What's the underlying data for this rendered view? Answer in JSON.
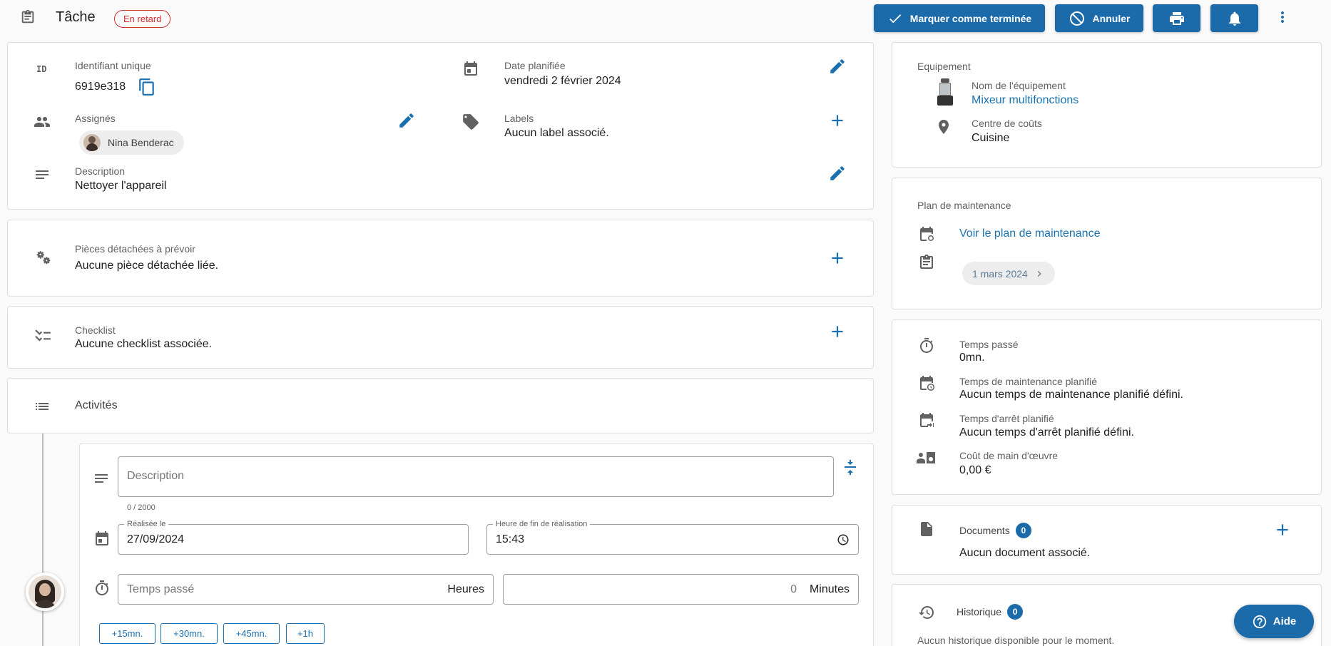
{
  "header": {
    "title": "Tâche",
    "status_badge": "En retard",
    "buttons": {
      "complete": "Marquer comme terminée",
      "cancel": "Annuler"
    }
  },
  "details": {
    "id_label": "Identifiant unique",
    "id_icon_text": "ID",
    "id_value": "6919e318",
    "date_label": "Date planifiée",
    "date_value": "vendredi 2 février 2024",
    "assignees_label": "Assignés",
    "assignee_name": "Nina Benderac",
    "labels_label": "Labels",
    "labels_value": "Aucun label associé.",
    "description_label": "Description",
    "description_value": "Nettoyer l'appareil"
  },
  "parts": {
    "label": "Pièces détachées à prévoir",
    "value": "Aucune pièce détachée liée."
  },
  "checklist": {
    "label": "Checklist",
    "value": "Aucune checklist associée."
  },
  "activities": {
    "title": "Activités",
    "description_placeholder": "Description",
    "char_count": "0 / 2000",
    "done_date_label": "Réalisée le",
    "done_date_value": "27/09/2024",
    "end_time_label": "Heure de fin de réalisation",
    "end_time_value": "15:43",
    "time_spent_placeholder": "Temps passé",
    "hours_unit": "Heures",
    "minutes_value": "0",
    "minutes_unit": "Minutes",
    "quick_buttons": [
      "+15mn.",
      "+30mn.",
      "+45mn.",
      "+1h"
    ]
  },
  "equipment": {
    "title": "Equipement",
    "name_label": "Nom de l'équipement",
    "name_value": "Mixeur multifonctions",
    "cost_center_label": "Centre de coûts",
    "cost_center_value": "Cuisine"
  },
  "maintenance_plan": {
    "title": "Plan de maintenance",
    "link": "Voir le plan de maintenance",
    "next_date": "1 mars 2024"
  },
  "times": {
    "spent_label": "Temps passé",
    "spent_value": "0mn.",
    "planned_label": "Temps de maintenance planifié",
    "planned_value": "Aucun temps de maintenance planifié défini.",
    "downtime_label": "Temps d'arrêt planifié",
    "downtime_value": "Aucun temps d'arrêt planifié défini.",
    "labor_label": "Coût de main d'œuvre",
    "labor_value": "0,00 €"
  },
  "documents": {
    "title": "Documents",
    "count": "0",
    "empty": "Aucun document associé."
  },
  "history": {
    "title": "Historique",
    "count": "0",
    "empty": "Aucun historique disponible pour le moment."
  },
  "help": {
    "label": "Aide"
  },
  "colors": {
    "primary": "#1b6bab",
    "danger": "#d32f2f",
    "link": "#1a73b0"
  }
}
